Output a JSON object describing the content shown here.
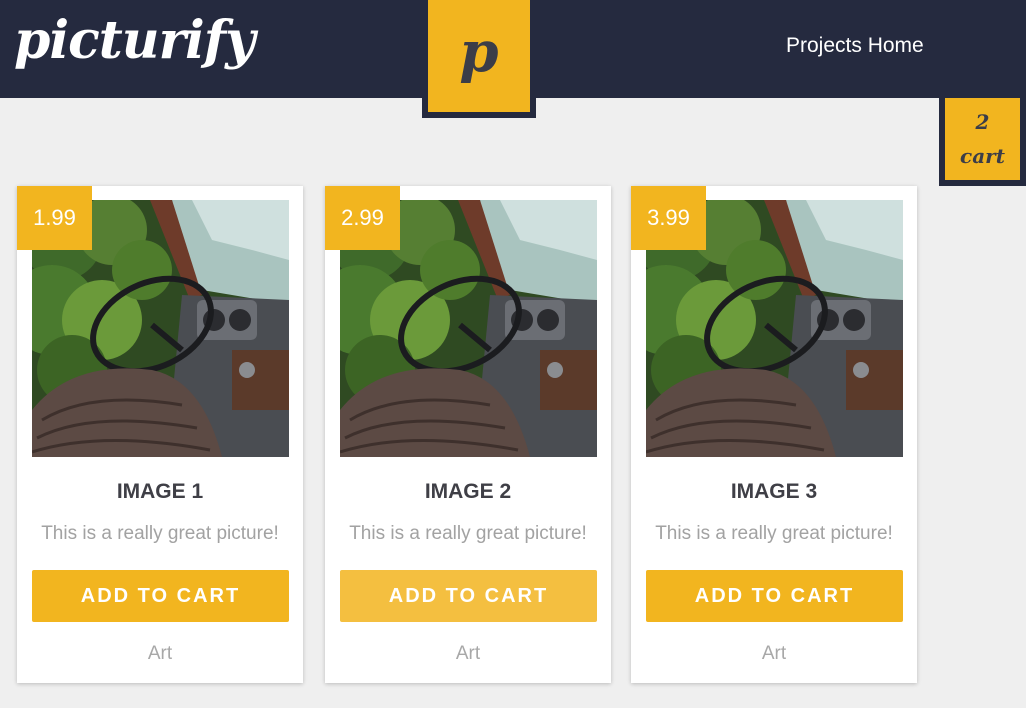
{
  "header": {
    "logo": "picturify",
    "badge_letter": "p",
    "nav_link": "Projects Home"
  },
  "cart": {
    "count": "2",
    "label": "cart"
  },
  "products": [
    {
      "price": "1.99",
      "title": "IMAGE 1",
      "description": "This is a really great picture!",
      "button": "ADD TO CART",
      "category": "Art"
    },
    {
      "price": "2.99",
      "title": "IMAGE 2",
      "description": "This is a really great picture!",
      "button": "ADD TO CART",
      "category": "Art"
    },
    {
      "price": "3.99",
      "title": "IMAGE 3",
      "description": "This is a really great picture!",
      "button": "ADD TO CART",
      "category": "Art"
    }
  ],
  "colors": {
    "header_bg": "#252a3f",
    "accent": "#f2b51f",
    "page_bg": "#efefef"
  },
  "icons": {
    "product_image": "truck-interior-photo"
  }
}
